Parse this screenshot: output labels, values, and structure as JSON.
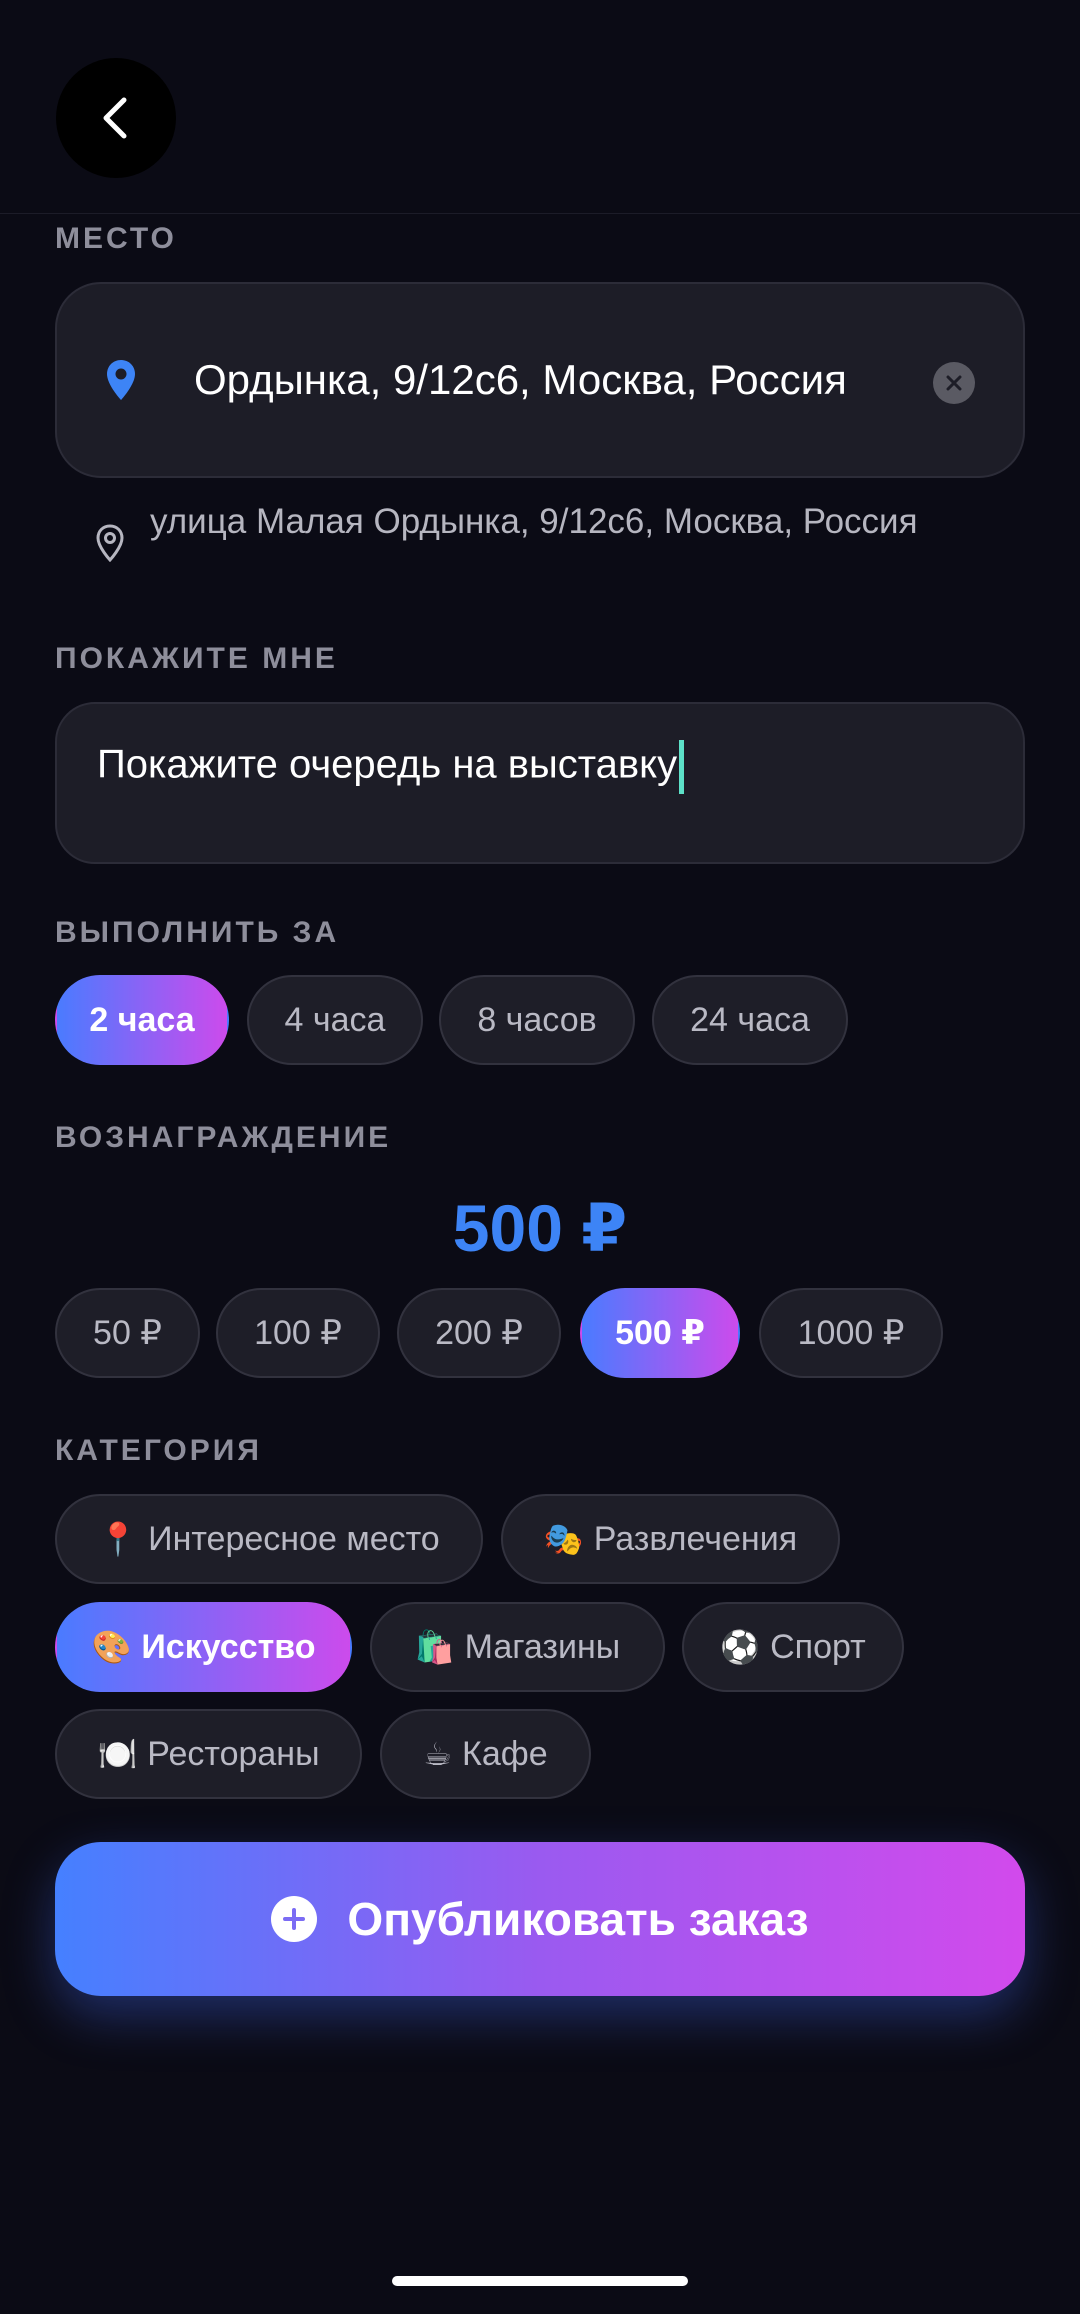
{
  "sections": {
    "place_label": "МЕСТО",
    "show_label": "ПОКАЖИТЕ МНЕ",
    "deadline_label": "ВЫПОЛНИТЬ ЗА",
    "reward_label": "ВОЗНАГРАЖДЕНИЕ",
    "category_label": "КАТЕГОРИЯ"
  },
  "place": {
    "value": "Ордынка, 9/12с6, Москва, Россия",
    "suggestion": "улица Малая Ордынка, 9/12с6, Москва, Россия"
  },
  "task": {
    "value": "Покажите очередь на выставку"
  },
  "deadline": {
    "options": [
      "2 часа",
      "4 часа",
      "8 часов",
      "24 часа"
    ],
    "selected": "2 часа"
  },
  "reward": {
    "amount": "500 ₽",
    "options": [
      "50 ₽",
      "100 ₽",
      "200 ₽",
      "500 ₽",
      "1000 ₽"
    ],
    "selected": "500 ₽"
  },
  "categories": {
    "items": [
      {
        "emoji": "📍",
        "label": "Интересное место"
      },
      {
        "emoji": "🎭",
        "label": "Развлечения"
      },
      {
        "emoji": "🎨",
        "label": "Искусство"
      },
      {
        "emoji": "🛍️",
        "label": "Магазины"
      },
      {
        "emoji": "⚽",
        "label": "Спорт"
      },
      {
        "emoji": "🍽️",
        "label": "Рестораны"
      },
      {
        "emoji": "☕",
        "label": "Кафе"
      }
    ],
    "selected": "Искусство"
  },
  "publish": {
    "label": "Опубликовать заказ"
  },
  "colors": {
    "background": "#0b0b15",
    "accent_blue": "#3d84f6",
    "gradient_start": "#4a7bff",
    "gradient_end": "#cc4bec",
    "caret": "#5de0c8"
  },
  "icons": {
    "back": "chevron-left-icon",
    "place": "map-pin-icon",
    "clear": "close-icon",
    "suggestion": "location-outline-icon",
    "publish": "plus-circle-icon"
  }
}
